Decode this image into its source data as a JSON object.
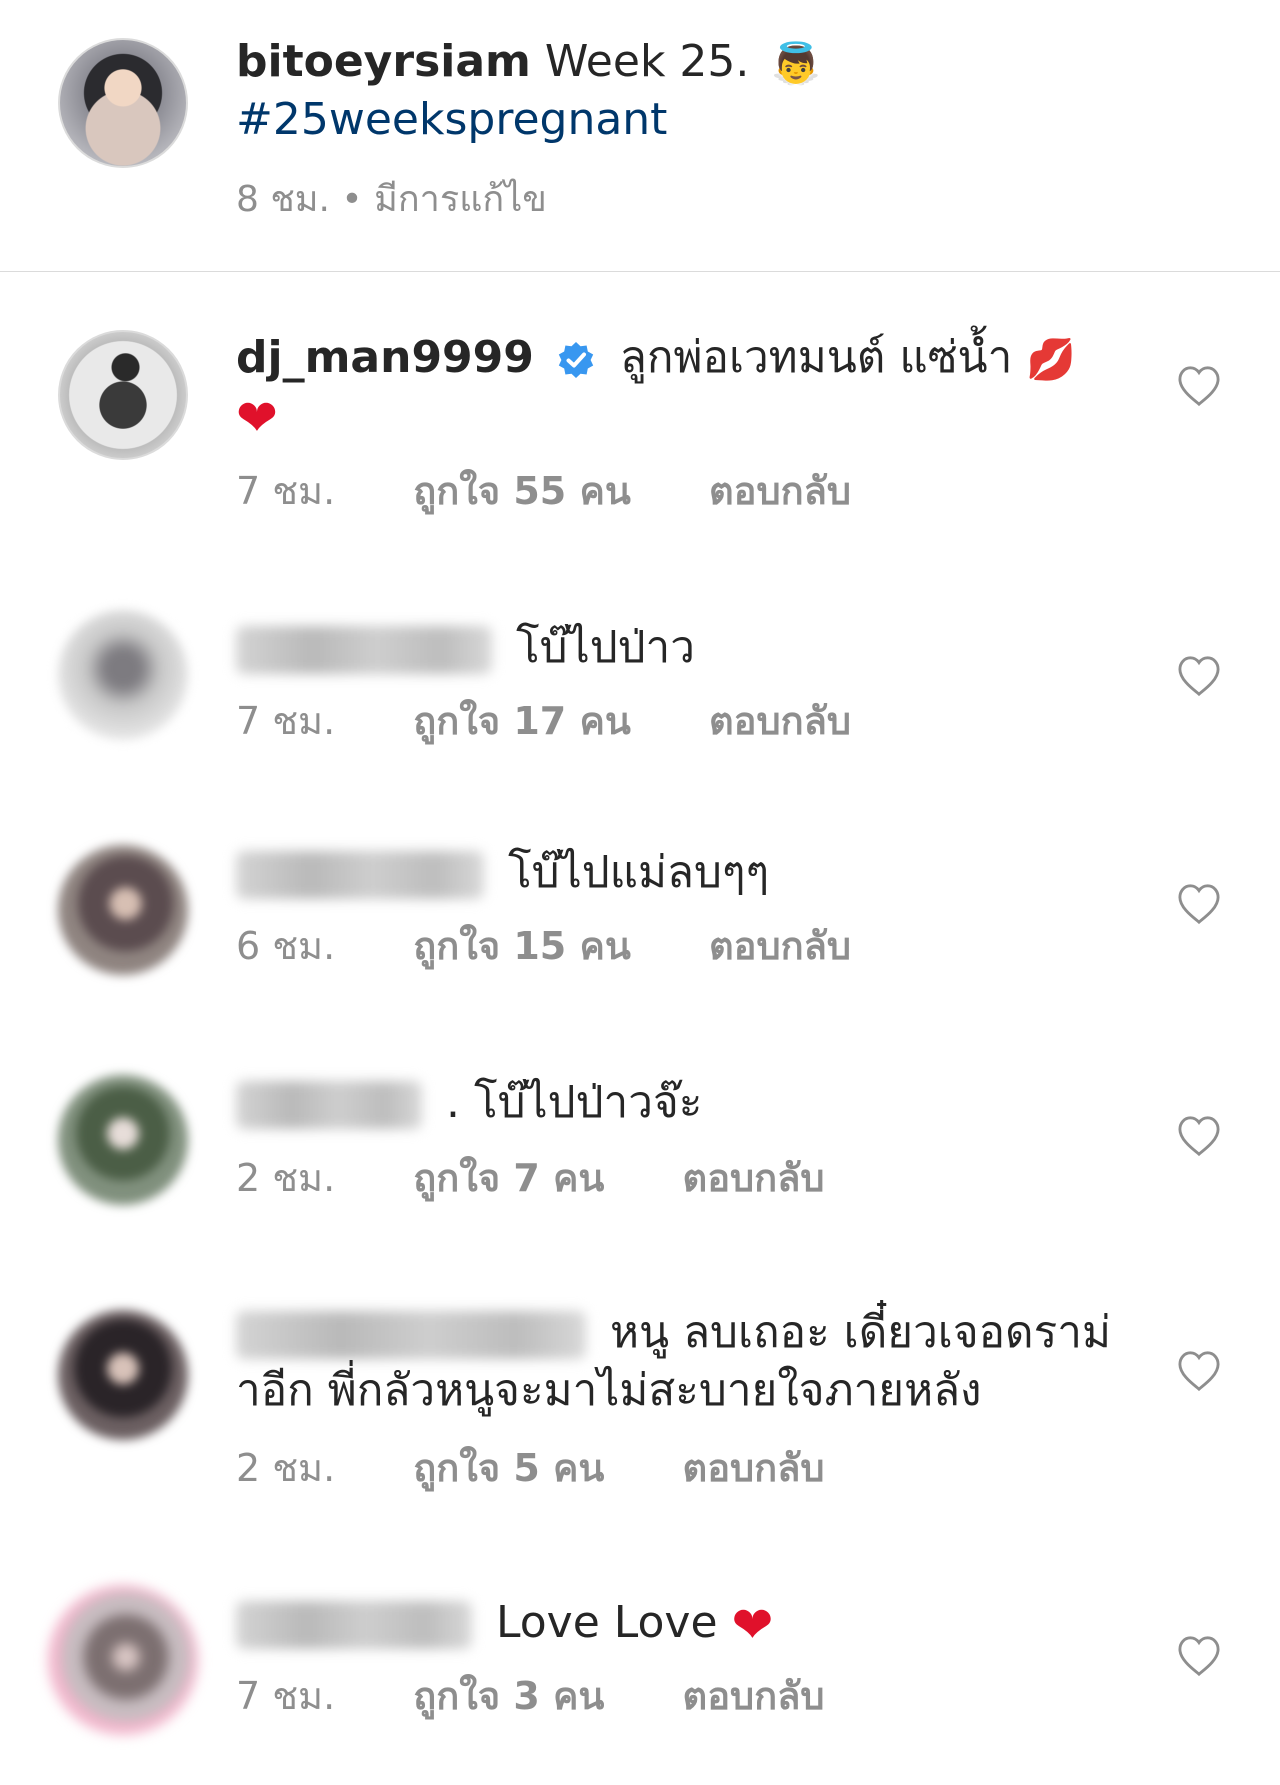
{
  "post": {
    "username": "bitoeyrsiam",
    "caption": "Week 25.",
    "caption_emoji": "👼",
    "hashtag": "#25weekspregnant",
    "time": "8 ชม.",
    "separator": "•",
    "edited": "มีการแก้ไข"
  },
  "comments": [
    {
      "username": "dj_man9999",
      "verified": true,
      "text_line_1": "ลูกพ่อเวทมนต์ แซ่น้ำ",
      "lips_emoji": "💋",
      "heart_emoji": "❤",
      "time": "7 ชม.",
      "likes": "ถูกใจ 55 คน",
      "reply": "ตอบกลับ"
    },
    {
      "username_blurred": true,
      "text_line_1": "โบ๊ไปป่าว",
      "time": "7 ชม.",
      "likes": "ถูกใจ 17 คน",
      "reply": "ตอบกลับ"
    },
    {
      "username_blurred": true,
      "text_line_1": "โบ๊ไปแม่ลบๆๆ",
      "time": "6 ชม.",
      "likes": "ถูกใจ 15 คน",
      "reply": "ตอบกลับ"
    },
    {
      "username_blurred": true,
      "text_line_1": ". โบ๊ไปป่าวจ๊ะ",
      "time": "2 ชม.",
      "likes": "ถูกใจ 7 คน",
      "reply": "ตอบกลับ"
    },
    {
      "username_blurred": true,
      "text_line_1": "หนู ลบเถอะ เดี๋ยวเจอดราม่",
      "text_line_2": "าอีก พี่กลัวหนูจะมาไม่สะบายใจภายหลัง",
      "time": "2 ชม.",
      "likes": "ถูกใจ 5 คน",
      "reply": "ตอบกลับ"
    },
    {
      "username_blurred": true,
      "text_line_1": "Love Love",
      "heart_emoji": "❤",
      "time": "7 ชม.",
      "likes": "ถูกใจ 3 คน",
      "reply": "ตอบกลับ"
    }
  ],
  "icons": {
    "like": "heart-outline-icon",
    "verified": "verified-badge-icon"
  },
  "colors": {
    "text": "#262626",
    "muted": "#8e8e8e",
    "hashtag": "#00376b",
    "verified": "#3897f0",
    "heart": "#e0112b",
    "divider": "#dbdbdb"
  }
}
